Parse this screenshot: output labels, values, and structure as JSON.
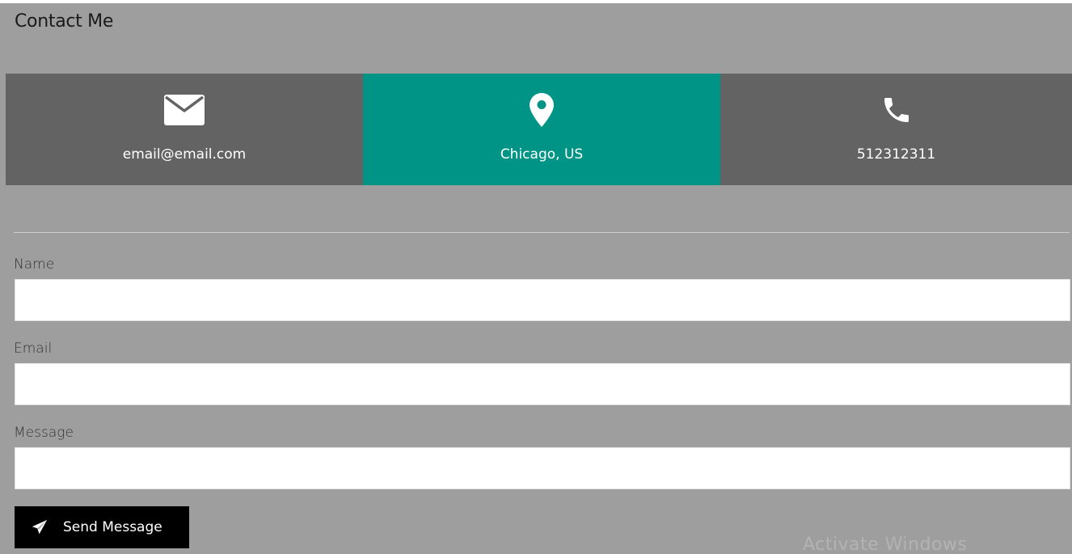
{
  "page": {
    "title": "Contact Me"
  },
  "info_cards": [
    {
      "icon": "envelope-icon",
      "text": "email@email.com",
      "active": false
    },
    {
      "icon": "map-pin-icon",
      "text": "Chicago, US",
      "active": true
    },
    {
      "icon": "phone-icon",
      "text": "512312311",
      "active": false
    }
  ],
  "form": {
    "name_label": "Name",
    "name_value": "",
    "email_label": "Email",
    "email_value": "",
    "message_label": "Message",
    "message_value": "",
    "submit_label": "Send Message",
    "submit_icon": "paper-plane-icon"
  },
  "watermark": {
    "text": "Activate Windows"
  },
  "colors": {
    "background": "#9e9e9e",
    "card": "#636363",
    "active_card": "#009486",
    "button": "#000000"
  }
}
